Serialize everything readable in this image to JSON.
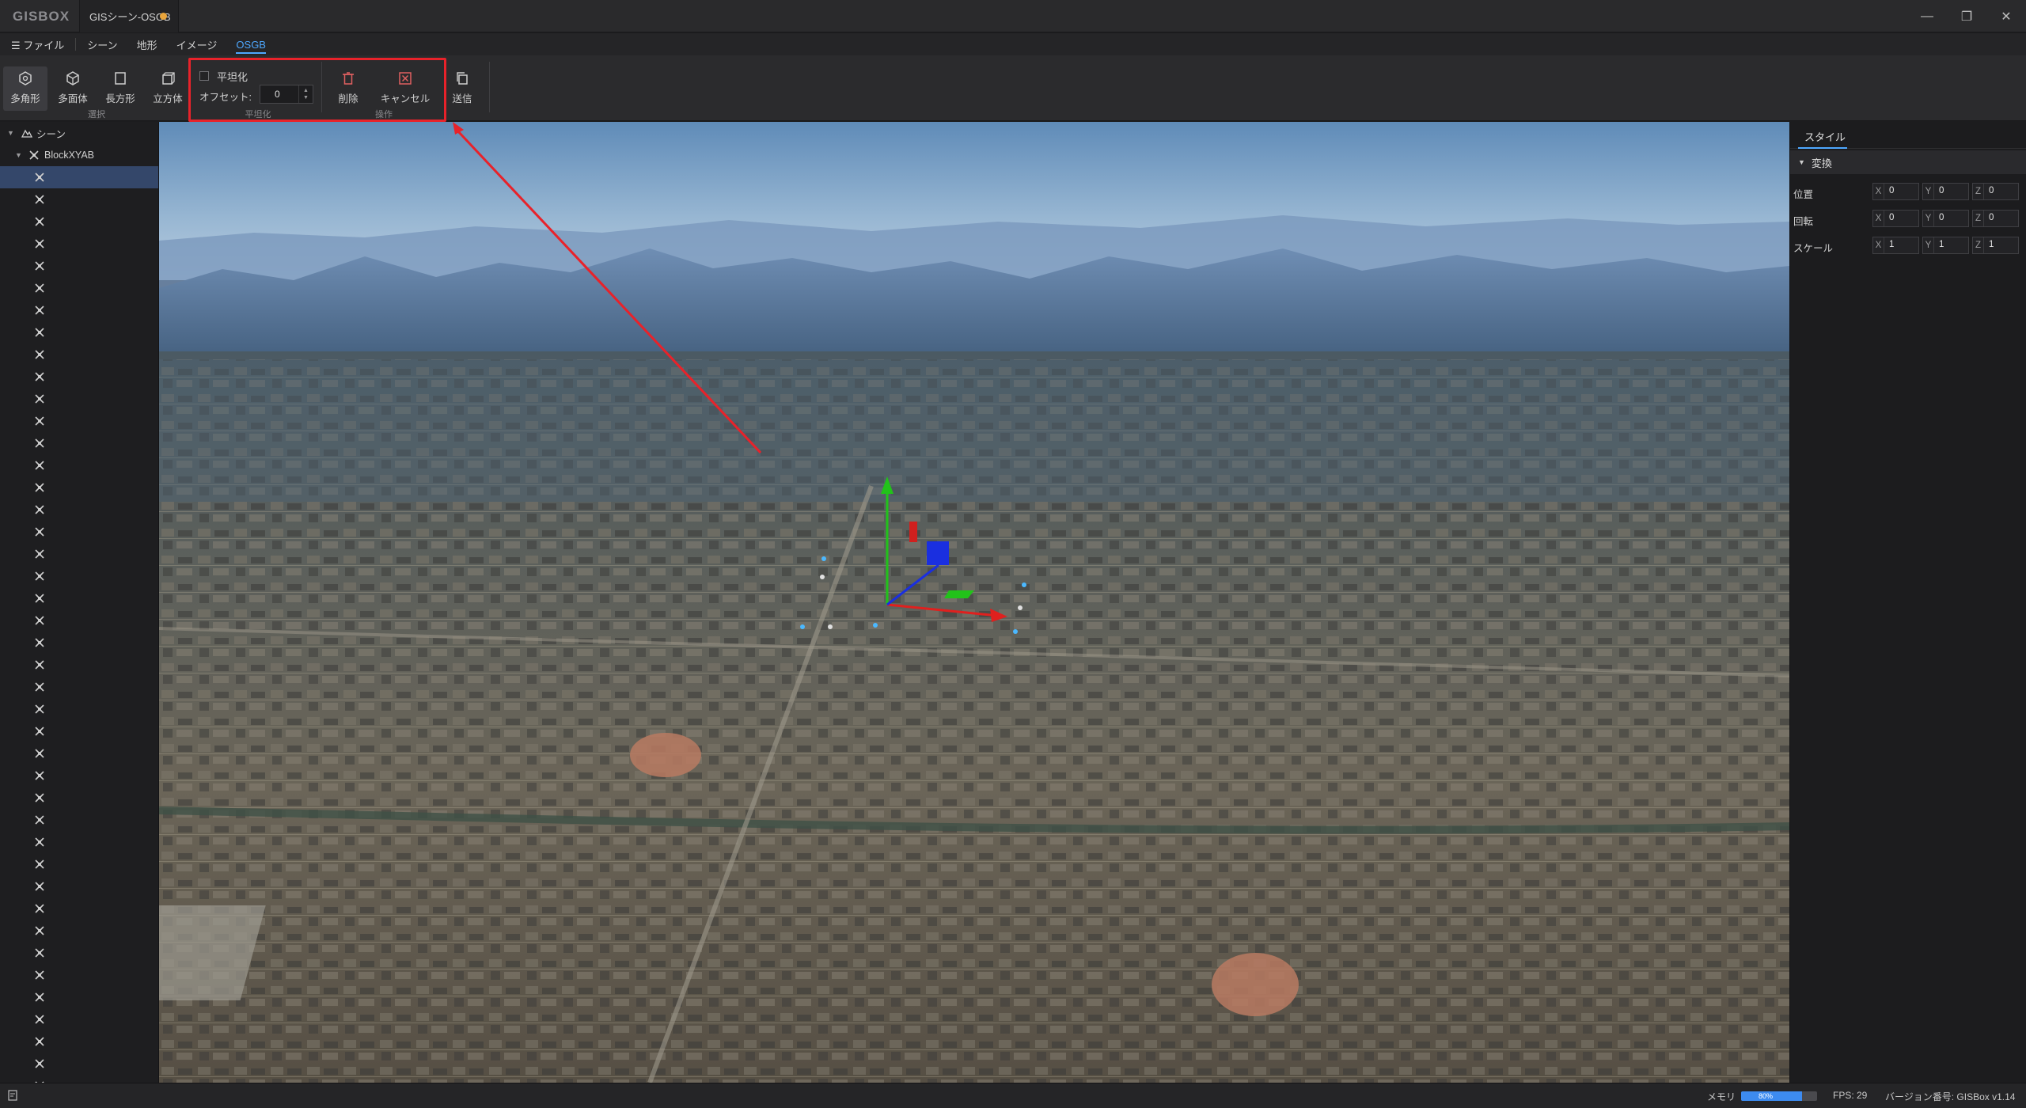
{
  "app": {
    "logo": "GISBOX",
    "doc_tab": "GISシーン-OSGB",
    "window": {
      "minimize": "—",
      "restore": "❐",
      "close": "✕"
    }
  },
  "menu": {
    "file": "☰ ファイル",
    "items": [
      "シーン",
      "地形",
      "イメージ",
      "OSGB"
    ],
    "active": "OSGB"
  },
  "ribbon": {
    "select_tools": [
      {
        "label": "多角形",
        "icon": "polygon-icon",
        "active": true
      },
      {
        "label": "多面体",
        "icon": "polyhedron-icon",
        "active": false
      },
      {
        "label": "長方形",
        "icon": "rectangle-icon",
        "active": false
      },
      {
        "label": "立方体",
        "icon": "cube-icon",
        "active": false
      }
    ],
    "select_group_label": "選択",
    "flatten_checkbox_label": "平坦化",
    "offset_label": "オフセット:",
    "offset_value": "0",
    "flatten_group_label": "平坦化",
    "delete_label": "削除",
    "cancel_label": "キャンセル",
    "operation_group_label": "操作",
    "send_label": "送信",
    "highlight_color": "#e8222a"
  },
  "tree": {
    "root_label": "シーン",
    "child_label": "BlockXYAB",
    "leaf_count": 42,
    "selected_index": 0
  },
  "viewport": {
    "gizmo_colors": {
      "x": "#e0201e",
      "y": "#22c21a",
      "z": "#1a2fe0"
    }
  },
  "right_panel": {
    "tab": "スタイル",
    "section": "変換",
    "rows": [
      {
        "label": "位置",
        "x": "0",
        "y": "0",
        "z": "0"
      },
      {
        "label": "回転",
        "x": "0",
        "y": "0",
        "z": "0"
      },
      {
        "label": "スケール",
        "x": "1",
        "y": "1",
        "z": "1"
      }
    ],
    "axis_labels": [
      "X",
      "Y",
      "Z"
    ]
  },
  "status": {
    "memory_label": "メモリ",
    "memory_percent": 80,
    "memory_text": "80%",
    "fps": "FPS: 29",
    "version": "バージョン番号: GISBox v1.14"
  }
}
